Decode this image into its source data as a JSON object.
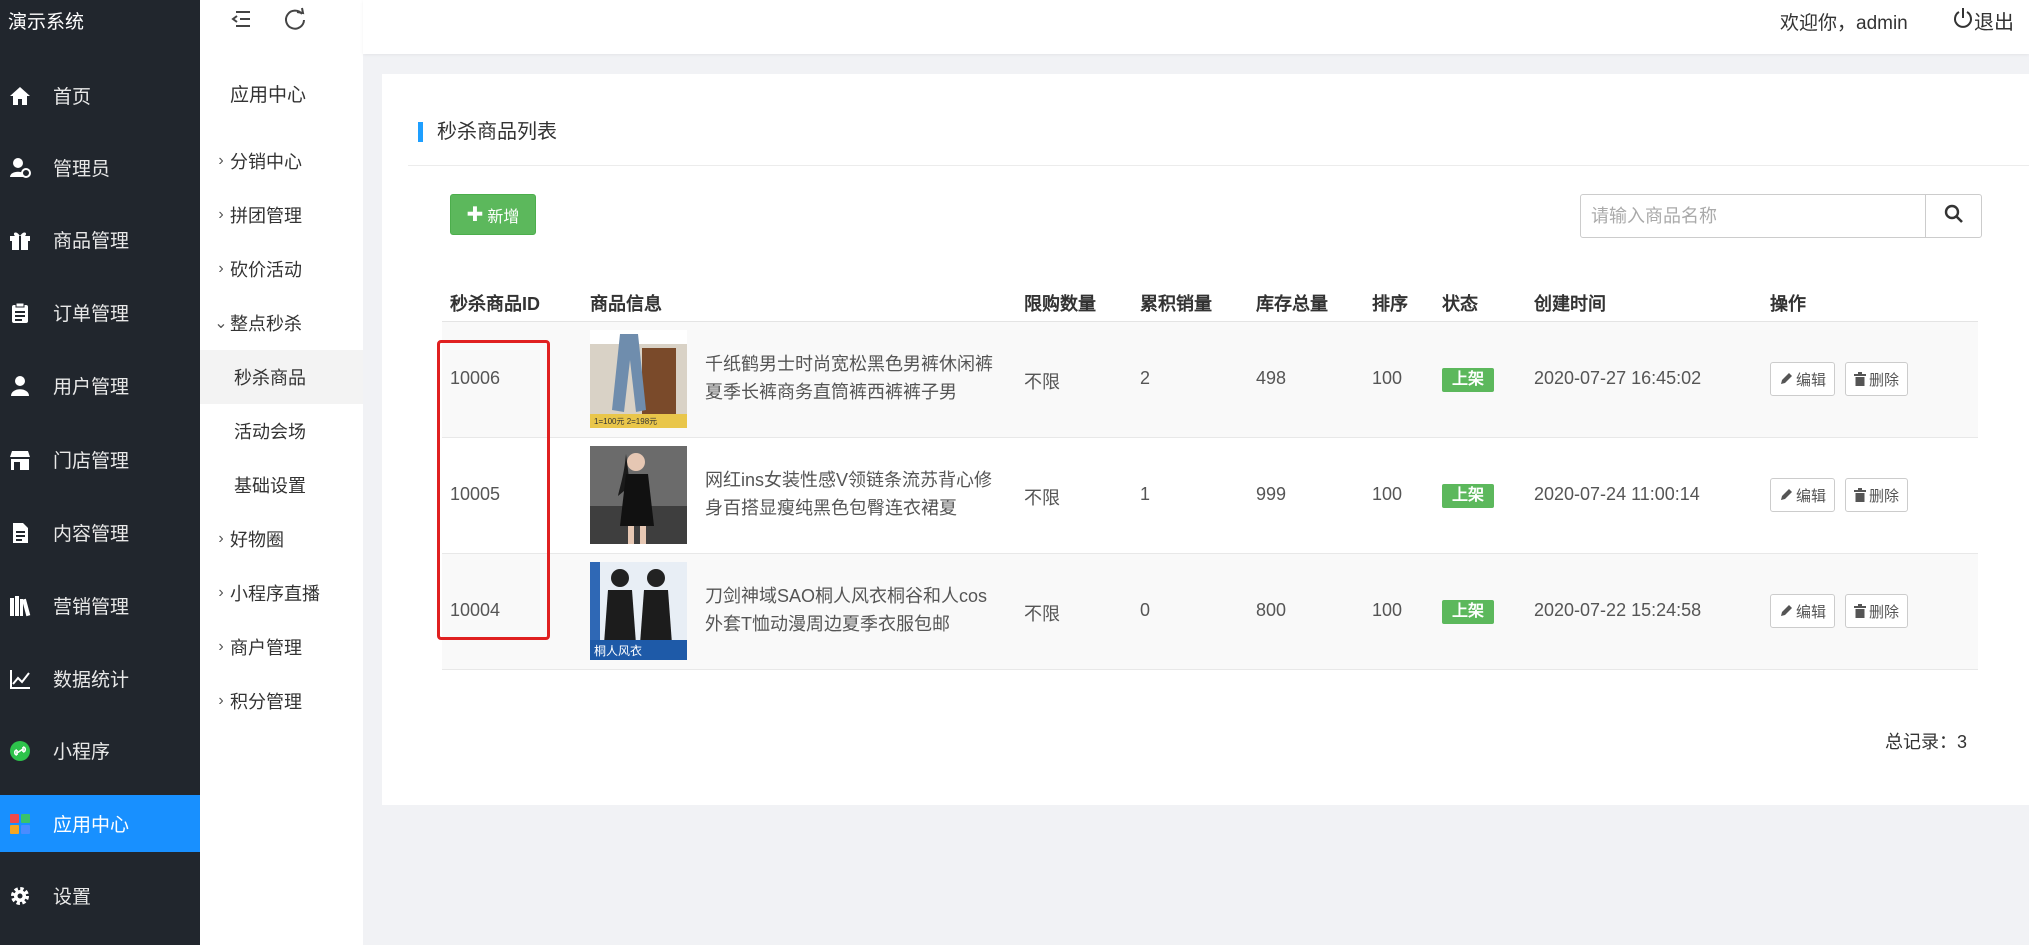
{
  "app": {
    "title": "演示系统"
  },
  "sidebar": {
    "items": [
      {
        "label": "首页",
        "icon": "home-icon"
      },
      {
        "label": "管理员",
        "icon": "admin-user-icon"
      },
      {
        "label": "商品管理",
        "icon": "gift-icon"
      },
      {
        "label": "订单管理",
        "icon": "clipboard-icon"
      },
      {
        "label": "用户管理",
        "icon": "user-icon"
      },
      {
        "label": "门店管理",
        "icon": "store-icon"
      },
      {
        "label": "内容管理",
        "icon": "document-icon"
      },
      {
        "label": "营销管理",
        "icon": "books-icon"
      },
      {
        "label": "数据统计",
        "icon": "line-chart-icon"
      },
      {
        "label": "小程序",
        "icon": "mini-program-icon"
      },
      {
        "label": "应用中心",
        "icon": "apps-icon",
        "active": true
      },
      {
        "label": "设置",
        "icon": "gear-icon"
      }
    ]
  },
  "subnav": {
    "title": "应用中心",
    "items": [
      {
        "label": "分销中心",
        "chevron": ">"
      },
      {
        "label": "拼团管理",
        "chevron": ">"
      },
      {
        "label": "砍价活动",
        "chevron": ">"
      },
      {
        "label": "整点秒杀",
        "chevron": "v"
      },
      {
        "label": "秒杀商品",
        "child": true,
        "selected": true
      },
      {
        "label": "活动会场",
        "child": true
      },
      {
        "label": "基础设置",
        "child": true
      },
      {
        "label": "好物圈",
        "chevron": ">"
      },
      {
        "label": "小程序直播",
        "chevron": ">"
      },
      {
        "label": "商户管理",
        "chevron": ">"
      },
      {
        "label": "积分管理",
        "chevron": ">"
      }
    ]
  },
  "header": {
    "welcome": "欢迎你，admin",
    "logout_label": "退出"
  },
  "page": {
    "title": "秒杀商品列表",
    "add_label": "新增",
    "search_placeholder": "请输入商品名称",
    "total_label": "总记录：3"
  },
  "table": {
    "columns": [
      "秒杀商品ID",
      "商品信息",
      "限购数量",
      "累积销量",
      "库存总量",
      "排序",
      "状态",
      "创建时间",
      "操作"
    ],
    "rows": [
      {
        "id": "10006",
        "name": "千纸鹤男士时尚宽松黑色男裤休闲裤夏季长裤商务直筒裤西裤裤子男",
        "limit": "不限",
        "sales": "2",
        "stock": "498",
        "sort": "100",
        "status": "上架",
        "created": "2020-07-27 16:45:02",
        "img_caption": "1=100元 2=198元"
      },
      {
        "id": "10005",
        "name": "网红ins女装性感V领链条流苏背心修身百搭显瘦纯黑色包臀连衣裙夏",
        "limit": "不限",
        "sales": "1",
        "stock": "999",
        "sort": "100",
        "status": "上架",
        "created": "2020-07-24 11:00:14",
        "img_caption": ""
      },
      {
        "id": "10004",
        "name": "刀剑神域SAO桐人风衣桐谷和人cos外套T恤动漫周边夏季衣服包邮",
        "limit": "不限",
        "sales": "0",
        "stock": "800",
        "sort": "100",
        "status": "上架",
        "created": "2020-07-22 15:24:58",
        "img_caption": "桐人风衣"
      }
    ],
    "edit_label": "编辑",
    "delete_label": "删除"
  },
  "colors": {
    "primary": "#1890ff",
    "success": "#5cb85c",
    "sidebar_bg": "#21262d",
    "highlight": "#e02020"
  }
}
